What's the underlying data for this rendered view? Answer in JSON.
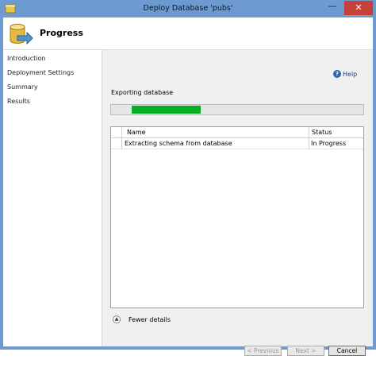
{
  "window": {
    "title": "Deploy Database 'pubs'"
  },
  "controls": {
    "minimize": "—",
    "close": "✕"
  },
  "header": {
    "title": "Progress"
  },
  "sidebar": {
    "items": [
      {
        "label": "Introduction"
      },
      {
        "label": "Deployment Settings"
      },
      {
        "label": "Summary"
      },
      {
        "label": "Results"
      }
    ]
  },
  "help": {
    "label": "Help"
  },
  "status": {
    "label": "Exporting database"
  },
  "progress": {
    "fraction": 0.26
  },
  "grid": {
    "columns": [
      "Name",
      "Status"
    ],
    "rows": [
      {
        "name": "Extracting schema from database",
        "status": "In Progress"
      }
    ]
  },
  "details": {
    "label": "Fewer details"
  },
  "footer": {
    "previous": "< Previous",
    "next": "Next >",
    "cancel": "Cancel"
  },
  "colors": {
    "accent": "#06b025",
    "titlebar": "#6d9ad0",
    "close": "#c8403a"
  }
}
